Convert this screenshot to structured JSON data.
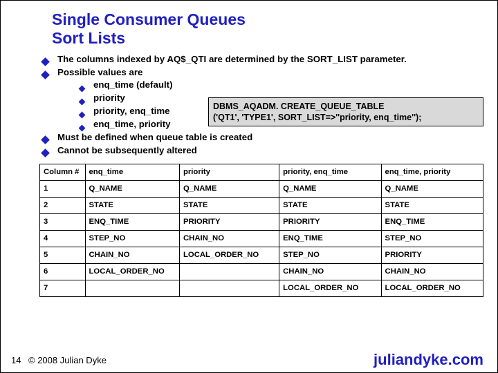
{
  "title_line1": "Single Consumer Queues",
  "title_line2": "Sort Lists",
  "bullets1": {
    "b1": "The columns indexed by AQ$_QTI are determined by the SORT_LIST parameter.",
    "b2": "Possible values are",
    "b3": "Must be defined when queue table is created",
    "b4": "Cannot be subsequently altered"
  },
  "bullets2": {
    "s1": "enq_time (default)",
    "s2": "priority",
    "s3": "priority, enq_time",
    "s4": "enq_time, priority"
  },
  "code_line1": "DBMS_AQADM. CREATE_QUEUE_TABLE",
  "code_line2": "('QT1', 'TYPE1', SORT_LIST=>''priority, enq_time'');",
  "chart_data": {
    "type": "table",
    "headers": [
      "Column #",
      "enq_time",
      "priority",
      "priority, enq_time",
      "enq_time, priority"
    ],
    "rows": [
      [
        "1",
        "Q_NAME",
        "Q_NAME",
        "Q_NAME",
        "Q_NAME"
      ],
      [
        "2",
        "STATE",
        "STATE",
        "STATE",
        "STATE"
      ],
      [
        "3",
        "ENQ_TIME",
        "PRIORITY",
        "PRIORITY",
        "ENQ_TIME"
      ],
      [
        "4",
        "STEP_NO",
        "CHAIN_NO",
        "ENQ_TIME",
        "STEP_NO"
      ],
      [
        "5",
        "CHAIN_NO",
        "LOCAL_ORDER_NO",
        "STEP_NO",
        "PRIORITY"
      ],
      [
        "6",
        "LOCAL_ORDER_NO",
        "",
        "CHAIN_NO",
        "CHAIN_NO"
      ],
      [
        "7",
        "",
        "",
        "LOCAL_ORDER_NO",
        "LOCAL_ORDER_NO"
      ]
    ]
  },
  "footer": {
    "num": "14",
    "copy": "© 2008 Julian Dyke",
    "site": "juliandyke.com"
  }
}
